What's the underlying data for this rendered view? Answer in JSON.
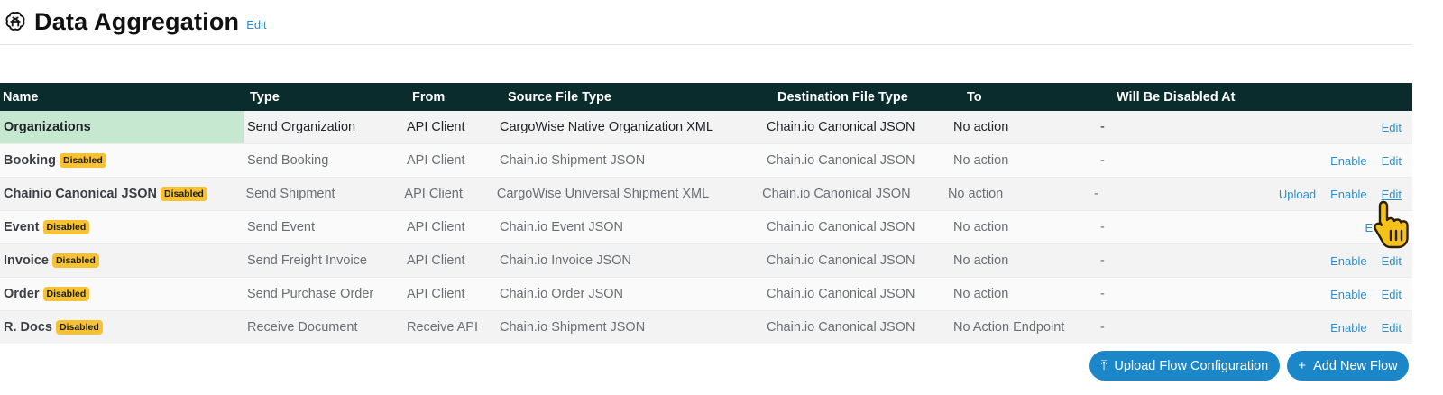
{
  "page": {
    "title": "Data Aggregation",
    "edit_label": "Edit"
  },
  "table": {
    "headers": [
      "Name",
      "Type",
      "From",
      "Source File Type",
      "Destination File Type",
      "To",
      "Will Be Disabled At"
    ],
    "rows": [
      {
        "name": "Organizations",
        "badge": "",
        "type": "Send Organization",
        "from": "API Client",
        "source": "CargoWise Native Organization XML",
        "dest": "Chain.io Canonical JSON",
        "to": "No action",
        "disabled_at": "-",
        "actions": [
          "Edit"
        ]
      },
      {
        "name": "Booking",
        "badge": "Disabled",
        "type": "Send Booking",
        "from": "API Client",
        "source": "Chain.io Shipment JSON",
        "dest": "Chain.io Canonical JSON",
        "to": "No action",
        "disabled_at": "-",
        "actions": [
          "Enable",
          "Edit"
        ]
      },
      {
        "name": "Chainio Canonical JSON",
        "badge": "Disabled",
        "type": "Send Shipment",
        "from": "API Client",
        "source": "CargoWise Universal Shipment XML",
        "dest": "Chain.io Canonical JSON",
        "to": "No action",
        "disabled_at": "-",
        "actions": [
          "Upload",
          "Enable",
          "Edit"
        ]
      },
      {
        "name": "Event",
        "badge": "Disabled",
        "type": "Send Event",
        "from": "API Client",
        "source": "Chain.io Event JSON",
        "dest": "Chain.io Canonical JSON",
        "to": "No action",
        "disabled_at": "-",
        "actions": [
          "Enable"
        ]
      },
      {
        "name": "Invoice",
        "badge": "Disabled",
        "type": "Send Freight Invoice",
        "from": "API Client",
        "source": "Chain.io Invoice JSON",
        "dest": "Chain.io Canonical JSON",
        "to": "No action",
        "disabled_at": "-",
        "actions": [
          "Enable",
          "Edit"
        ]
      },
      {
        "name": "Order",
        "badge": "Disabled",
        "type": "Send Purchase Order",
        "from": "API Client",
        "source": "Chain.io Order JSON",
        "dest": "Chain.io Canonical JSON",
        "to": "No action",
        "disabled_at": "-",
        "actions": [
          "Enable",
          "Edit"
        ]
      },
      {
        "name": "R. Docs",
        "badge": "Disabled",
        "type": "Receive Document",
        "from": "Receive API",
        "source": "Chain.io Shipment JSON",
        "dest": "Chain.io Canonical JSON",
        "to": "No Action Endpoint",
        "disabled_at": "-",
        "actions": [
          "Enable",
          "Edit"
        ]
      }
    ]
  },
  "buttons": {
    "upload_flow": "Upload Flow Configuration",
    "add_flow": "Add New Flow"
  },
  "colors": {
    "header_bg": "#0b2c2c",
    "accent": "#1b87c9",
    "badge": "#f6c234",
    "active_row": "#c6e7d0",
    "link": "#2a8fd1"
  },
  "icons": {
    "logo": "openai-knot-icon",
    "upload": "upload-icon",
    "add": "plus-icon",
    "cursor": "hand-pointer-icon"
  }
}
